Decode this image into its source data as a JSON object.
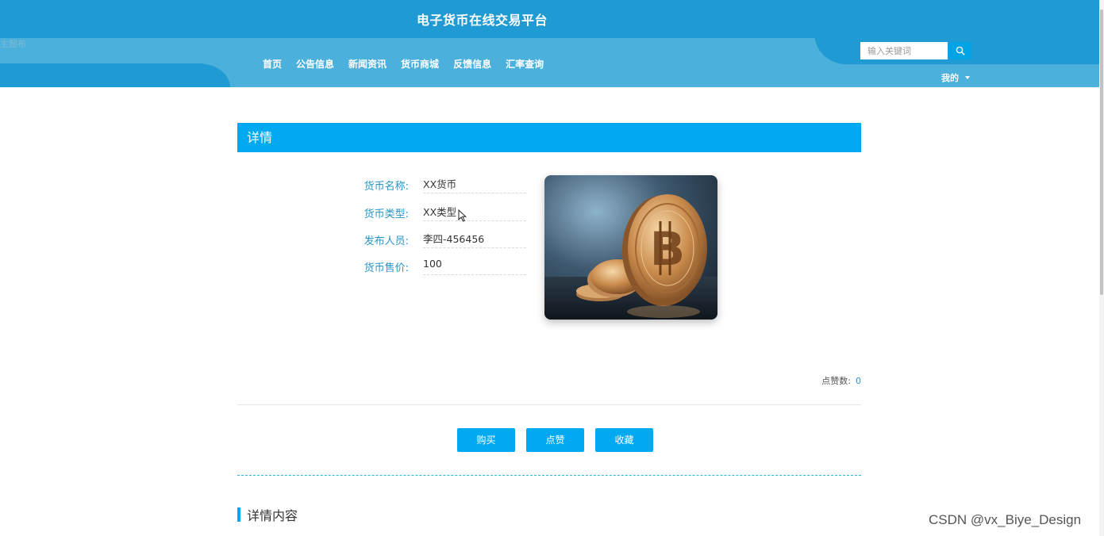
{
  "header": {
    "site_title": "电子货币在线交易平台",
    "ghost_text": "主题布"
  },
  "nav": {
    "items": [
      "首页",
      "公告信息",
      "新闻资讯",
      "货币商城",
      "反馈信息",
      "汇率查询"
    ]
  },
  "search": {
    "placeholder": "输入关键词"
  },
  "user_menu": {
    "label": "我的"
  },
  "detail": {
    "section_title": "详情",
    "fields": [
      {
        "label": "货币名称:",
        "value": "XX货币"
      },
      {
        "label": "货币类型:",
        "value": "XX类型"
      },
      {
        "label": "发布人员:",
        "value": "李四-456456"
      },
      {
        "label": "货币售价:",
        "value": "100"
      }
    ],
    "likes_label": "点赞数:",
    "likes_count": "0",
    "buttons": {
      "buy": "购买",
      "like": "点赞",
      "favorite": "收藏"
    },
    "content_title": "详情内容"
  },
  "watermark": "CSDN @vx_Biye_Design",
  "colors": {
    "header": "#1f9ad2",
    "nav": "#4cb0dc",
    "accent": "#00a9f0",
    "label": "#2a95c5"
  },
  "icons": {
    "search": "search-icon",
    "caret": "caret-down-icon",
    "image": "bitcoin-coin-image"
  }
}
